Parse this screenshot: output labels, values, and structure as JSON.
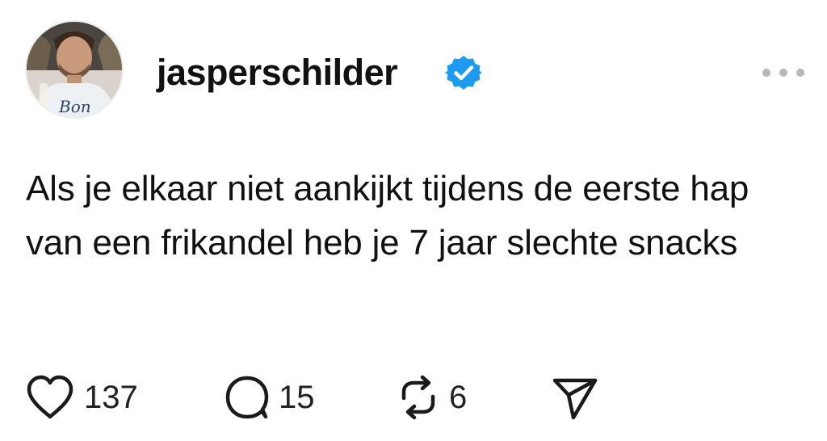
{
  "post": {
    "username": "jasperschilder",
    "verified": true,
    "avatar_caption": "Bon",
    "text": "Als je elkaar niet aankijkt tijdens de eerste hap van een frikandel heb je 7 jaar slechte snacks",
    "actions": {
      "likes": "137",
      "replies": "15",
      "reposts": "6"
    }
  },
  "colors": {
    "background": "#ffffff",
    "text": "#111111",
    "verified_badge": "#1d9bf0",
    "more_dots": "#b8b8b8"
  },
  "icons": {
    "more": "more-horizontal-icon",
    "like": "heart-icon",
    "reply": "speech-bubble-icon",
    "repost": "repost-icon",
    "share": "paper-plane-icon",
    "verified": "verified-badge-icon"
  }
}
